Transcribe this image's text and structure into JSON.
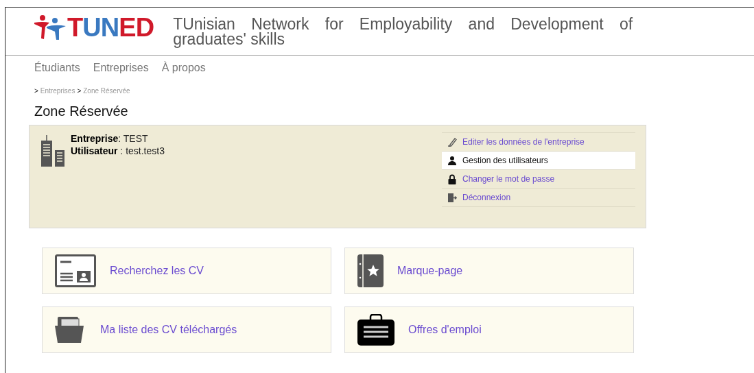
{
  "header": {
    "logo": "TUNED",
    "tagline": "TUnisian Network for Employability and Development of graduates' skills"
  },
  "nav": [
    "Étudiants",
    "Entreprises",
    "À propos"
  ],
  "breadcrumb": [
    {
      "sep": ">",
      "label": "Entreprises"
    },
    {
      "sep": ">",
      "label": "Zone Réservée"
    }
  ],
  "heading": "Zone Réservée",
  "account": {
    "fields": [
      {
        "label": "Entreprise",
        "value": ": TEST"
      },
      {
        "label": "Utilisateur",
        "value": " : test.test3"
      }
    ],
    "menu": [
      {
        "kind": "pencil",
        "label": "Editer les données de l'entreprise",
        "selected": false
      },
      {
        "kind": "user",
        "label": "Gestion des utilisateurs",
        "selected": true
      },
      {
        "kind": "lock",
        "label": "Changer le mot de passe",
        "selected": false
      },
      {
        "kind": "logout",
        "label": "Déconnexion",
        "selected": false
      }
    ]
  },
  "tiles": [
    {
      "kind": "cv",
      "label": "Recherchez les CV"
    },
    {
      "kind": "bookmark",
      "label": "Marque-page"
    },
    {
      "kind": "folder",
      "label": "Ma liste des CV téléchargés"
    },
    {
      "kind": "briefcase",
      "label": "Offres d'emploi"
    }
  ]
}
